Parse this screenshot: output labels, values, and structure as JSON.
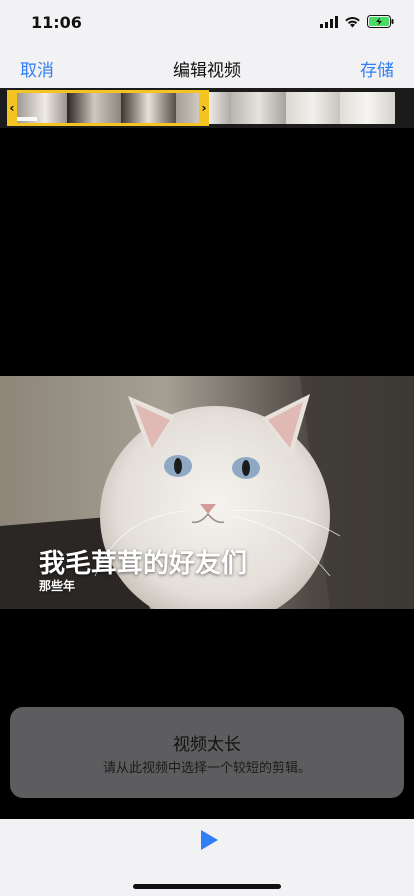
{
  "status": {
    "time": "11:06"
  },
  "nav": {
    "cancel_label": "取消",
    "title": "编辑视频",
    "save_label": "存储"
  },
  "video": {
    "caption_title": "我毛茸茸的好友们",
    "caption_subtitle": "那些年"
  },
  "alert": {
    "title": "视频太长",
    "message": "请从此视频中选择一个较短的剪辑。"
  },
  "colors": {
    "accent": "#2f7ef7",
    "trim_handle": "#f4c422"
  },
  "icons": {
    "signal": "cellular-signal-icon",
    "wifi": "wifi-icon",
    "battery": "battery-charging-icon",
    "play": "play-icon"
  }
}
